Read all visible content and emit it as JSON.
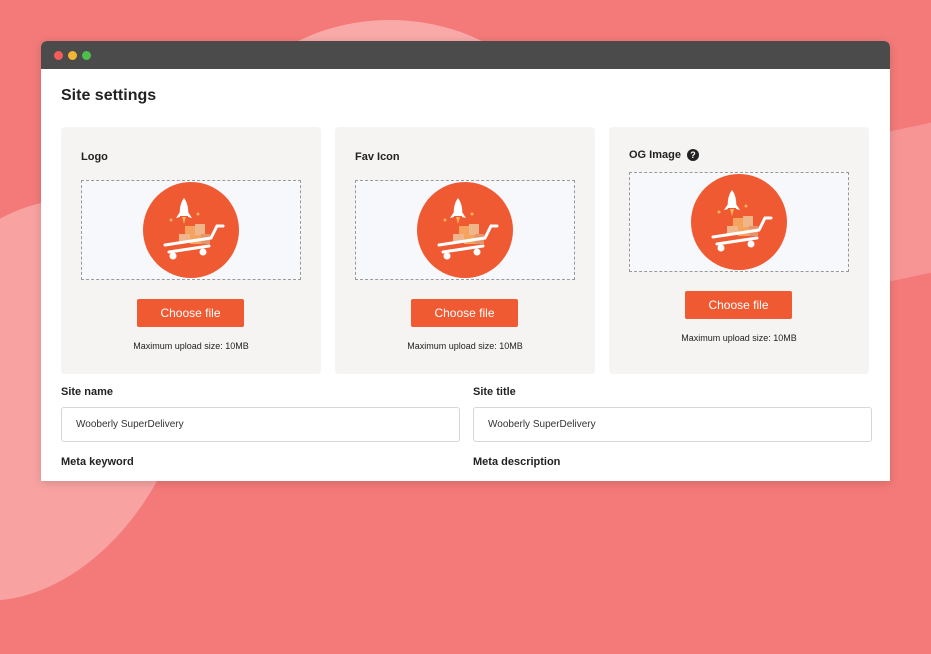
{
  "page": {
    "title": "Site settings"
  },
  "uploads": [
    {
      "label": "Logo",
      "button": "Choose file",
      "hint": "Maximum upload size: 10MB"
    },
    {
      "label": "Fav Icon",
      "button": "Choose file",
      "hint": "Maximum upload size: 10MB"
    },
    {
      "label": "OG Image",
      "help": "?",
      "button": "Choose file",
      "hint": "Maximum upload size: 10MB"
    }
  ],
  "fields": {
    "site_name": {
      "label": "Site name",
      "value": "Wooberly SuperDelivery"
    },
    "site_title": {
      "label": "Site title",
      "value": "Wooberly SuperDelivery"
    },
    "meta_keyword": {
      "label": "Meta keyword"
    },
    "meta_description": {
      "label": "Meta description"
    }
  },
  "colors": {
    "accent": "#ef5a33",
    "background": "#f47a79"
  }
}
